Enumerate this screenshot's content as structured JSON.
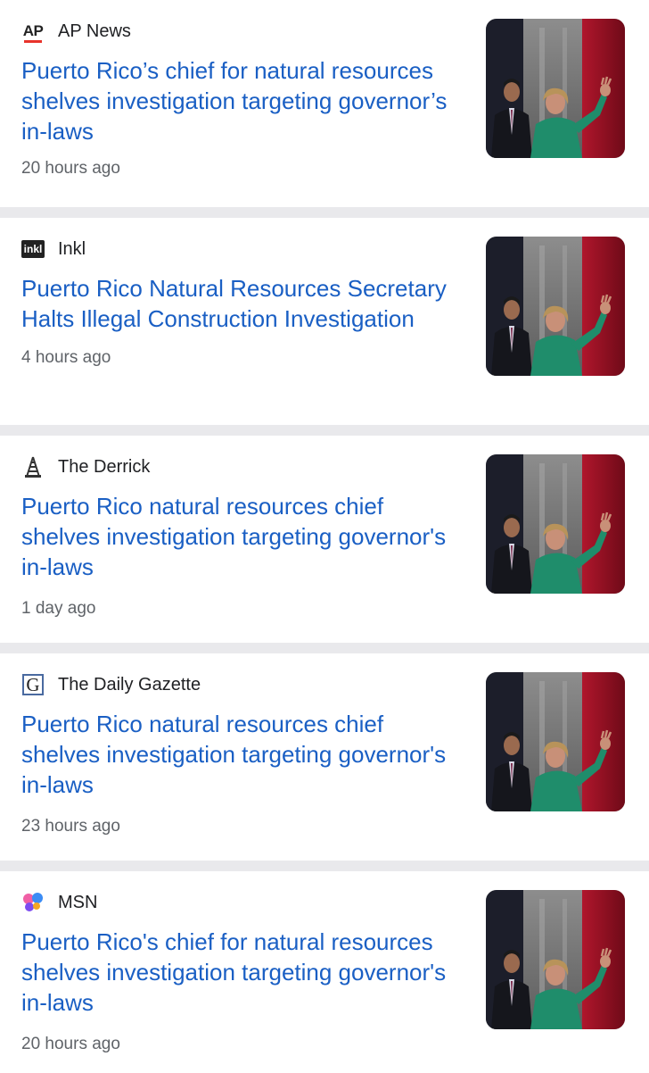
{
  "articles": [
    {
      "source": "AP News",
      "logo_icon": "ap-logo-icon",
      "headline": "Puerto Rico’s chief for natural resources shelves investigation targeting governor’s in-laws",
      "time": "20 hours ago"
    },
    {
      "source": "Inkl",
      "logo_icon": "inkl-logo-icon",
      "logo_text": "inkl",
      "headline": "Puerto Rico Natural Resources Secretary Halts Illegal Construction Investigation",
      "time": "4 hours ago"
    },
    {
      "source": "The Derrick",
      "logo_icon": "derrick-logo-icon",
      "headline": "Puerto Rico natural resources chief shelves investigation targeting governor's in-laws",
      "time": "1 day ago"
    },
    {
      "source": "The Daily Gazette",
      "logo_icon": "gazette-logo-icon",
      "logo_text": "G",
      "headline": "Puerto Rico natural resources chief shelves investigation targeting governor's in-laws",
      "time": "23 hours ago"
    },
    {
      "source": "MSN",
      "logo_icon": "msn-logo-icon",
      "headline": "Puerto Rico's chief for natural resources shelves investigation targeting governor's in-laws",
      "time": "20 hours ago"
    }
  ],
  "colors": {
    "headline": "#1a5fc4",
    "source": "#202124",
    "time": "#5f6368",
    "separator": "#e9e9ec",
    "ap_red": "#e8332b"
  }
}
